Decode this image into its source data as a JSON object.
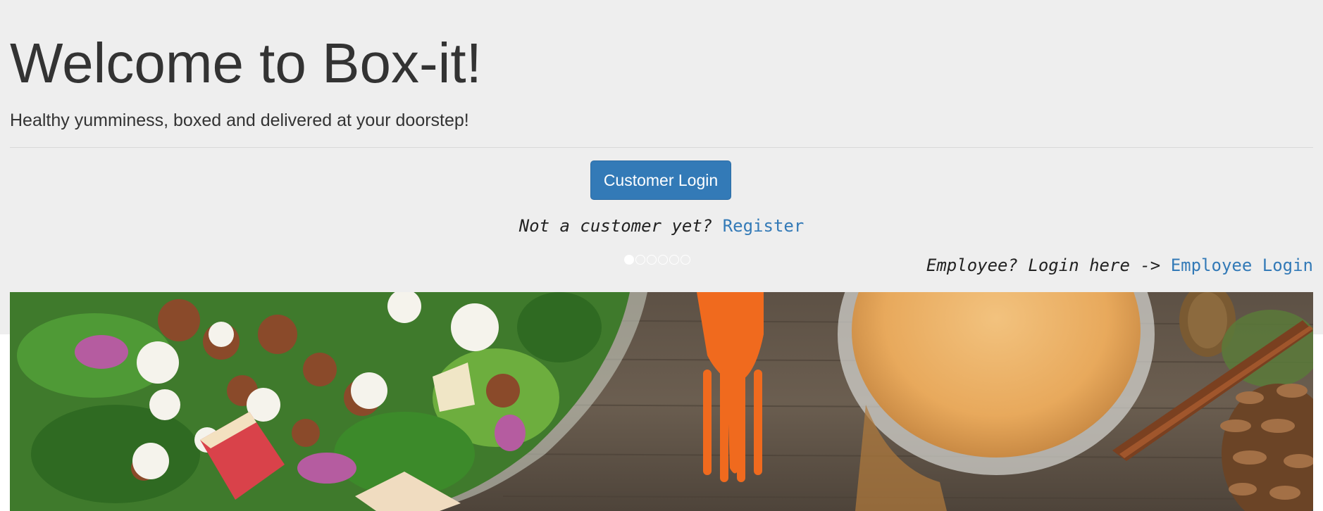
{
  "header": {
    "title": "Welcome to Box-it!",
    "tagline": "Healthy yumminess, boxed and delivered at your doorstep!"
  },
  "customer_login": {
    "button_label": "Customer Login"
  },
  "register": {
    "prompt": "Not a customer yet?",
    "link_label": "Register"
  },
  "carousel": {
    "slide_count": 6,
    "active_index": 0
  },
  "employee": {
    "prompt": "Employee? Login here ->",
    "link_label": "Employee Login"
  },
  "banner": {
    "icon": "food-banner-image"
  },
  "colors": {
    "jumbotron_bg": "#eeeeee",
    "primary": "#337ab7",
    "link": "#337ab7",
    "text": "#333333"
  }
}
